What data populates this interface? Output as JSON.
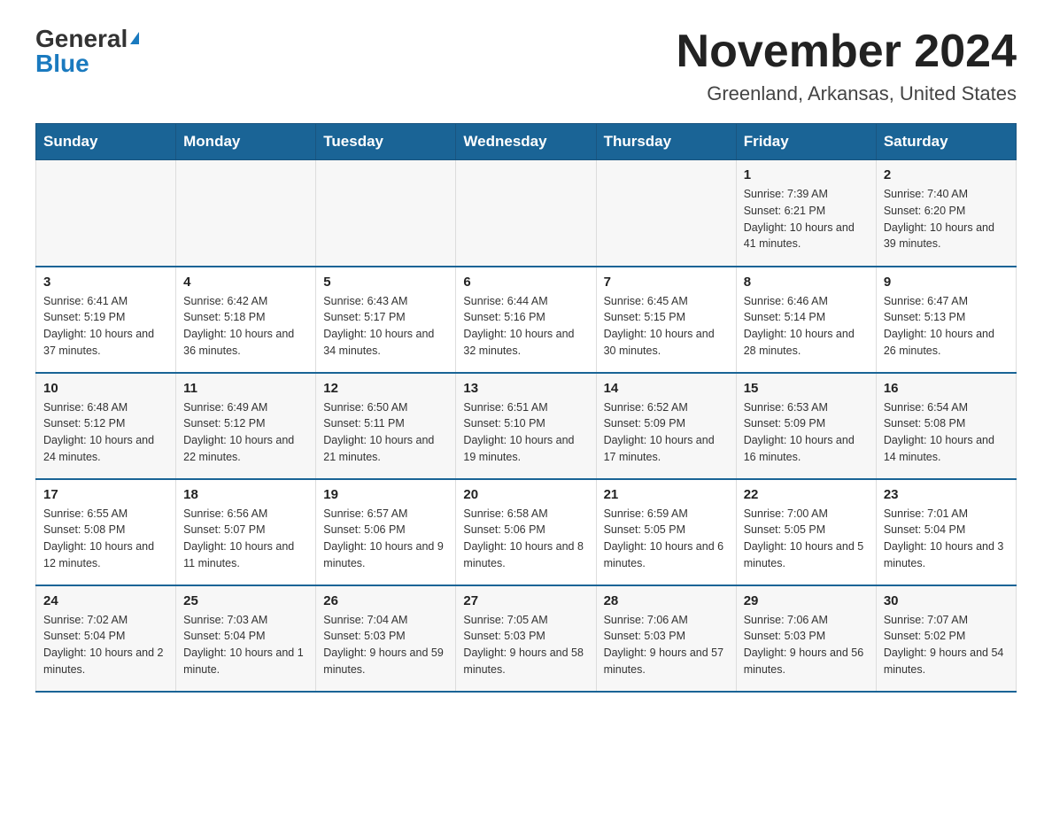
{
  "logo": {
    "general": "General",
    "blue": "Blue"
  },
  "title": "November 2024",
  "subtitle": "Greenland, Arkansas, United States",
  "days_of_week": [
    "Sunday",
    "Monday",
    "Tuesday",
    "Wednesday",
    "Thursday",
    "Friday",
    "Saturday"
  ],
  "weeks": [
    [
      {
        "day": "",
        "info": ""
      },
      {
        "day": "",
        "info": ""
      },
      {
        "day": "",
        "info": ""
      },
      {
        "day": "",
        "info": ""
      },
      {
        "day": "",
        "info": ""
      },
      {
        "day": "1",
        "info": "Sunrise: 7:39 AM\nSunset: 6:21 PM\nDaylight: 10 hours and 41 minutes."
      },
      {
        "day": "2",
        "info": "Sunrise: 7:40 AM\nSunset: 6:20 PM\nDaylight: 10 hours and 39 minutes."
      }
    ],
    [
      {
        "day": "3",
        "info": "Sunrise: 6:41 AM\nSunset: 5:19 PM\nDaylight: 10 hours and 37 minutes."
      },
      {
        "day": "4",
        "info": "Sunrise: 6:42 AM\nSunset: 5:18 PM\nDaylight: 10 hours and 36 minutes."
      },
      {
        "day": "5",
        "info": "Sunrise: 6:43 AM\nSunset: 5:17 PM\nDaylight: 10 hours and 34 minutes."
      },
      {
        "day": "6",
        "info": "Sunrise: 6:44 AM\nSunset: 5:16 PM\nDaylight: 10 hours and 32 minutes."
      },
      {
        "day": "7",
        "info": "Sunrise: 6:45 AM\nSunset: 5:15 PM\nDaylight: 10 hours and 30 minutes."
      },
      {
        "day": "8",
        "info": "Sunrise: 6:46 AM\nSunset: 5:14 PM\nDaylight: 10 hours and 28 minutes."
      },
      {
        "day": "9",
        "info": "Sunrise: 6:47 AM\nSunset: 5:13 PM\nDaylight: 10 hours and 26 minutes."
      }
    ],
    [
      {
        "day": "10",
        "info": "Sunrise: 6:48 AM\nSunset: 5:12 PM\nDaylight: 10 hours and 24 minutes."
      },
      {
        "day": "11",
        "info": "Sunrise: 6:49 AM\nSunset: 5:12 PM\nDaylight: 10 hours and 22 minutes."
      },
      {
        "day": "12",
        "info": "Sunrise: 6:50 AM\nSunset: 5:11 PM\nDaylight: 10 hours and 21 minutes."
      },
      {
        "day": "13",
        "info": "Sunrise: 6:51 AM\nSunset: 5:10 PM\nDaylight: 10 hours and 19 minutes."
      },
      {
        "day": "14",
        "info": "Sunrise: 6:52 AM\nSunset: 5:09 PM\nDaylight: 10 hours and 17 minutes."
      },
      {
        "day": "15",
        "info": "Sunrise: 6:53 AM\nSunset: 5:09 PM\nDaylight: 10 hours and 16 minutes."
      },
      {
        "day": "16",
        "info": "Sunrise: 6:54 AM\nSunset: 5:08 PM\nDaylight: 10 hours and 14 minutes."
      }
    ],
    [
      {
        "day": "17",
        "info": "Sunrise: 6:55 AM\nSunset: 5:08 PM\nDaylight: 10 hours and 12 minutes."
      },
      {
        "day": "18",
        "info": "Sunrise: 6:56 AM\nSunset: 5:07 PM\nDaylight: 10 hours and 11 minutes."
      },
      {
        "day": "19",
        "info": "Sunrise: 6:57 AM\nSunset: 5:06 PM\nDaylight: 10 hours and 9 minutes."
      },
      {
        "day": "20",
        "info": "Sunrise: 6:58 AM\nSunset: 5:06 PM\nDaylight: 10 hours and 8 minutes."
      },
      {
        "day": "21",
        "info": "Sunrise: 6:59 AM\nSunset: 5:05 PM\nDaylight: 10 hours and 6 minutes."
      },
      {
        "day": "22",
        "info": "Sunrise: 7:00 AM\nSunset: 5:05 PM\nDaylight: 10 hours and 5 minutes."
      },
      {
        "day": "23",
        "info": "Sunrise: 7:01 AM\nSunset: 5:04 PM\nDaylight: 10 hours and 3 minutes."
      }
    ],
    [
      {
        "day": "24",
        "info": "Sunrise: 7:02 AM\nSunset: 5:04 PM\nDaylight: 10 hours and 2 minutes."
      },
      {
        "day": "25",
        "info": "Sunrise: 7:03 AM\nSunset: 5:04 PM\nDaylight: 10 hours and 1 minute."
      },
      {
        "day": "26",
        "info": "Sunrise: 7:04 AM\nSunset: 5:03 PM\nDaylight: 9 hours and 59 minutes."
      },
      {
        "day": "27",
        "info": "Sunrise: 7:05 AM\nSunset: 5:03 PM\nDaylight: 9 hours and 58 minutes."
      },
      {
        "day": "28",
        "info": "Sunrise: 7:06 AM\nSunset: 5:03 PM\nDaylight: 9 hours and 57 minutes."
      },
      {
        "day": "29",
        "info": "Sunrise: 7:06 AM\nSunset: 5:03 PM\nDaylight: 9 hours and 56 minutes."
      },
      {
        "day": "30",
        "info": "Sunrise: 7:07 AM\nSunset: 5:02 PM\nDaylight: 9 hours and 54 minutes."
      }
    ]
  ]
}
